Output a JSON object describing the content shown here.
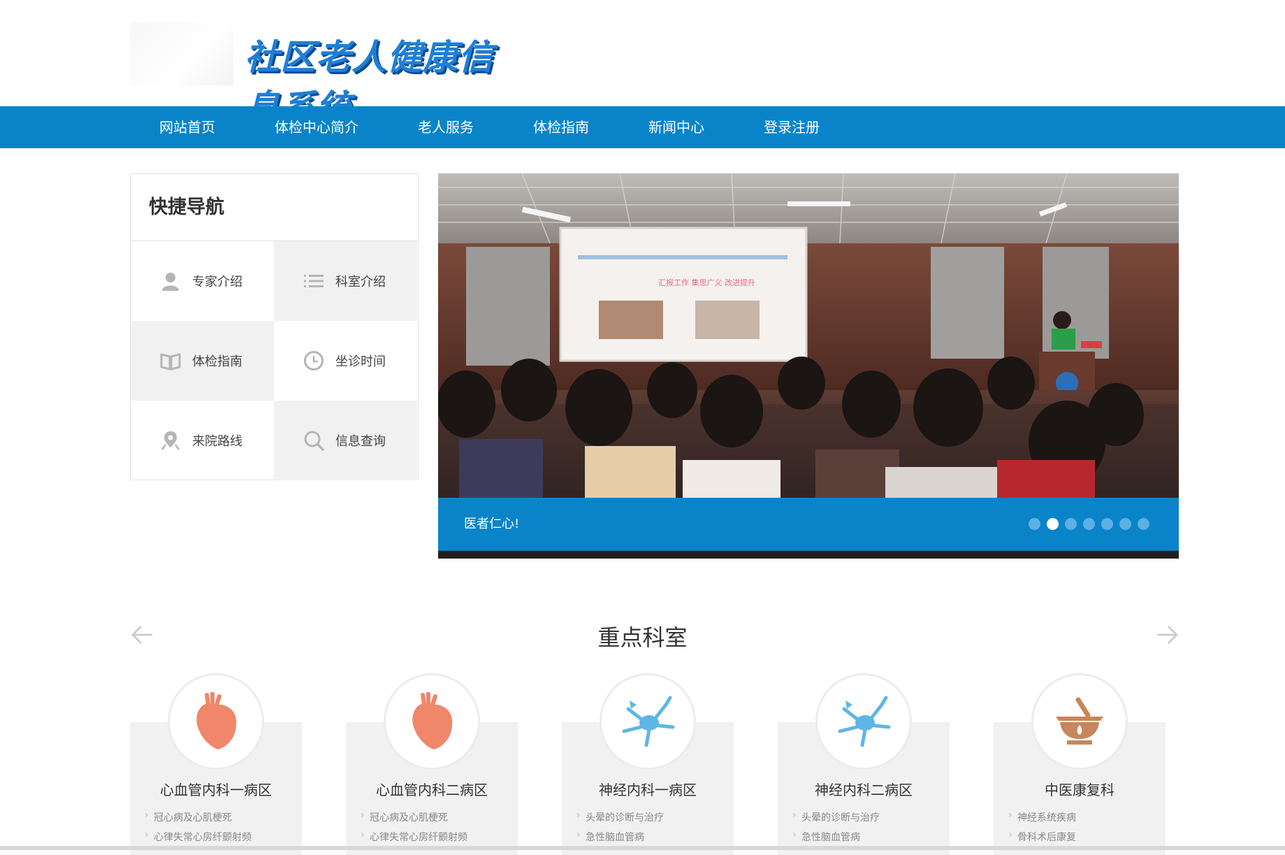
{
  "header": {
    "site_title": "社区老人健康信息系统"
  },
  "nav": {
    "items": [
      "网站首页",
      "体检中心简介",
      "老人服务",
      "体检指南",
      "新闻中心",
      "登录注册"
    ]
  },
  "quick_nav": {
    "title": "快捷导航",
    "items": [
      {
        "label": "专家介绍",
        "icon": "user-icon"
      },
      {
        "label": "科室介绍",
        "icon": "list-icon"
      },
      {
        "label": "体检指南",
        "icon": "book-icon"
      },
      {
        "label": "坐诊时间",
        "icon": "clock-icon"
      },
      {
        "label": "来院路线",
        "icon": "location-icon"
      },
      {
        "label": "信息查询",
        "icon": "search-icon"
      }
    ]
  },
  "slider": {
    "caption": "医者仁心!",
    "dot_count": 7,
    "active_dot": 2,
    "slide_screen_text": [
      "汇报工作 集思广义 改进提升"
    ],
    "colors": {
      "bar": "#0a84c9"
    }
  },
  "departments": {
    "title": "重点科室",
    "items": [
      {
        "name": "心血管内科一病区",
        "icon": "heart-icon",
        "subs": [
          "冠心病及心肌梗死",
          "心律失常心房纤颤射频"
        ]
      },
      {
        "name": "心血管内科二病区",
        "icon": "heart-icon",
        "subs": [
          "冠心病及心肌梗死",
          "心律失常心房纤颤射频"
        ]
      },
      {
        "name": "神经内科一病区",
        "icon": "neuron-icon",
        "subs": [
          "头晕的诊断与治疗",
          "急性脑血管病"
        ]
      },
      {
        "name": "神经内科二病区",
        "icon": "neuron-icon",
        "subs": [
          "头晕的诊断与治疗",
          "急性脑血管病"
        ]
      },
      {
        "name": "中医康复科",
        "icon": "mortar-icon",
        "subs": [
          "神经系统疾病",
          "骨科术后康复"
        ]
      }
    ]
  },
  "theme": {
    "primary": "#0a84c9",
    "heart": "#f0866a",
    "neuron": "#5fb6e4",
    "mortar": "#c8865a"
  }
}
